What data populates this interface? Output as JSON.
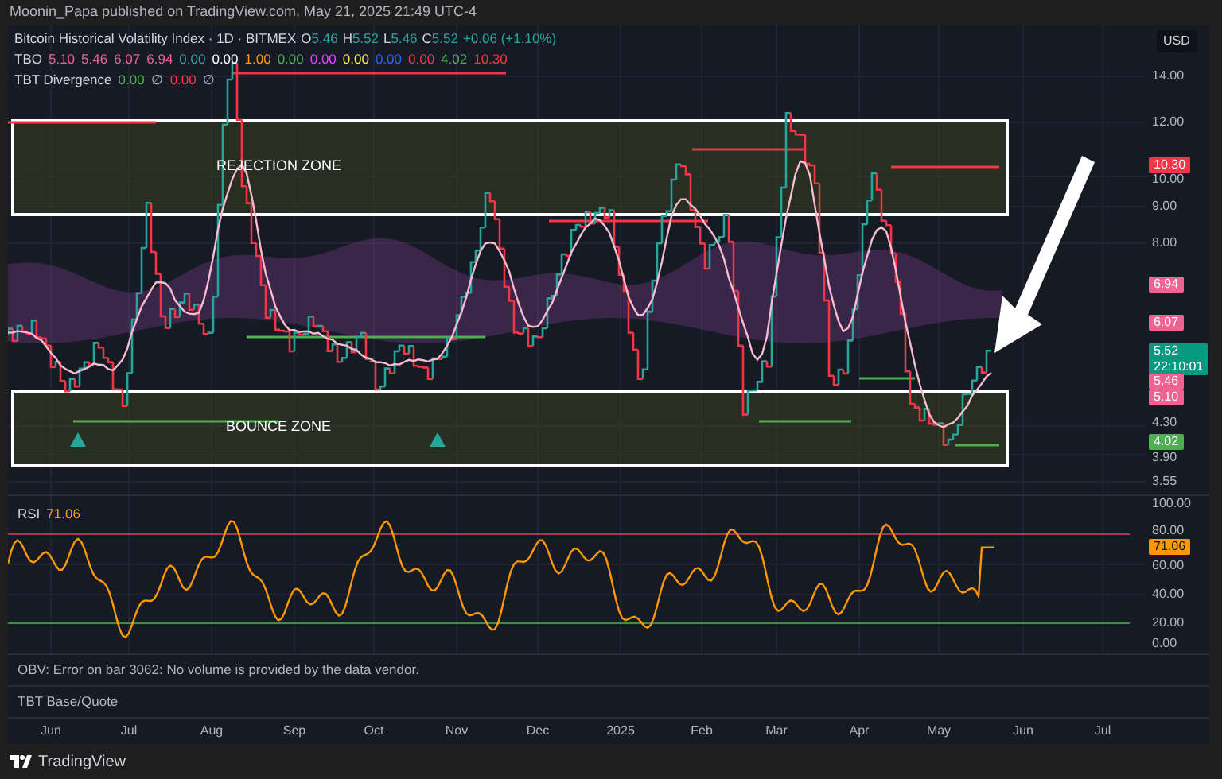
{
  "header": {
    "text": "Moonin_Papa published on TradingView.com, May 21, 2025 21:49 UTC-4"
  },
  "legend": {
    "title": "Bitcoin Historical Volatility Index · 1D · BITMEX",
    "ohlc": [
      {
        "label": "O",
        "value": "5.46"
      },
      {
        "label": "H",
        "value": "5.52"
      },
      {
        "label": "L",
        "value": "5.46"
      },
      {
        "label": "C",
        "value": "5.52"
      }
    ],
    "change": "+0.06 (+1.10%)",
    "indicators": [
      {
        "name": "TBO",
        "values": [
          {
            "text": "5.10",
            "color": "#f06292"
          },
          {
            "text": "5.46",
            "color": "#f06292"
          },
          {
            "text": "6.07",
            "color": "#f06292"
          },
          {
            "text": "6.94",
            "color": "#f06292"
          },
          {
            "text": "0.00",
            "color": "#26a69a"
          },
          {
            "text": "0.00",
            "color": "#ffffff"
          },
          {
            "text": "1.00",
            "color": "#ff9800"
          },
          {
            "text": "0.00",
            "color": "#4caf50"
          },
          {
            "text": "0.00",
            "color": "#e040fb"
          },
          {
            "text": "0.00",
            "color": "#ffeb3b"
          },
          {
            "text": "0.00",
            "color": "#2962ff"
          },
          {
            "text": "0.00",
            "color": "#f23645"
          },
          {
            "text": "4.02",
            "color": "#4caf50"
          },
          {
            "text": "10.30",
            "color": "#f23645"
          }
        ]
      },
      {
        "name": "TBT Divergence",
        "values": [
          {
            "text": "0.00",
            "color": "#4caf50"
          },
          {
            "text": "∅",
            "color": "#b2b5be"
          },
          {
            "text": "0.00",
            "color": "#f23645"
          },
          {
            "text": "∅",
            "color": "#b2b5be"
          }
        ]
      }
    ]
  },
  "zones": [
    {
      "label": "REJECTION ZONE"
    },
    {
      "label": "BOUNCE ZONE"
    }
  ],
  "price_axis": {
    "currency": "USD",
    "ticks": [
      "14.00",
      "12.00",
      "10.00",
      "9.00",
      "8.00",
      "4.30",
      "3.90",
      "3.55"
    ],
    "tags": [
      {
        "text": "10.30",
        "color": "#f23645"
      },
      {
        "text": "6.94",
        "color": "#f06292"
      },
      {
        "text": "6.07",
        "color": "#f06292"
      },
      {
        "text": "5.52",
        "countdown": "22:10:01",
        "color": "#089981"
      },
      {
        "text": "5.46",
        "color": "#f06292"
      },
      {
        "text": "5.10",
        "color": "#f06292"
      },
      {
        "text": "4.02",
        "color": "#4caf50"
      }
    ]
  },
  "rsi": {
    "label": "RSI",
    "value": "71.06",
    "ticks": [
      "100.00",
      "80.00",
      "60.00",
      "40.00",
      "20.00",
      "0.00"
    ],
    "tag": {
      "text": "71.06",
      "color": "#ff9800"
    }
  },
  "panes": [
    {
      "text": "OBV: Error on bar 3062: No volume is provided by the data vendor."
    },
    {
      "text": "TBT Base/Quote"
    }
  ],
  "time_axis": [
    "Jun",
    "Jul",
    "Aug",
    "Sep",
    "Oct",
    "Nov",
    "Dec",
    "2025",
    "Feb",
    "Mar",
    "Apr",
    "May",
    "Jun",
    "Jul"
  ],
  "footer": {
    "brand": "TradingView"
  }
}
